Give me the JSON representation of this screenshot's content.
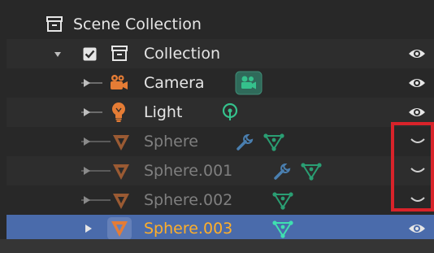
{
  "outliner": {
    "rows": [
      {
        "label": "Scene Collection",
        "state": "normal",
        "visible": null
      },
      {
        "label": "Collection",
        "state": "normal",
        "visible": true,
        "checked": true
      },
      {
        "label": "Camera",
        "state": "normal",
        "visible": true
      },
      {
        "label": "Light",
        "state": "normal",
        "visible": true
      },
      {
        "label": "Sphere",
        "state": "hidden",
        "visible": false
      },
      {
        "label": "Sphere.001",
        "state": "hidden",
        "visible": false
      },
      {
        "label": "Sphere.002",
        "state": "hidden",
        "visible": false
      },
      {
        "label": "Sphere.003",
        "state": "selected-active",
        "visible": true
      }
    ]
  },
  "colors": {
    "background": "#282828",
    "selected_row": "#4a6bab",
    "active_text": "#ffaf29",
    "hidden_text": "#7f7f7f",
    "normal_text": "#e6e6e6",
    "object_orange": "#e57c35",
    "data_green": "#35c18c",
    "highlight_red": "#d8232a"
  }
}
